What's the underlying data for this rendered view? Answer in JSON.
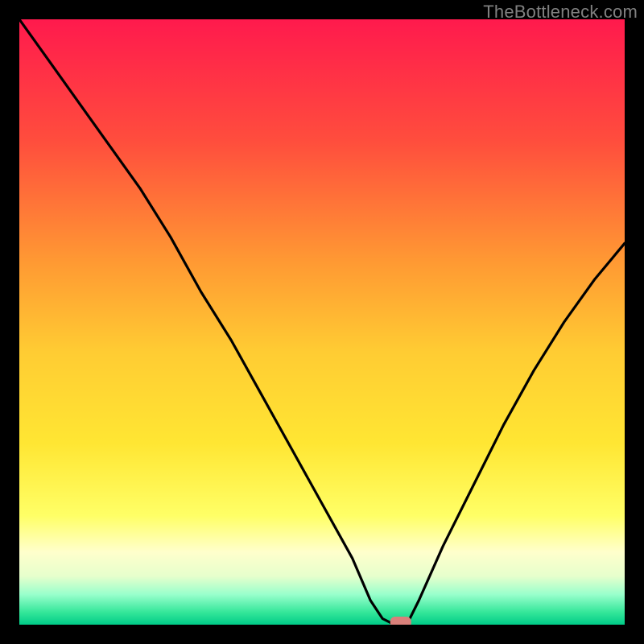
{
  "watermark": "TheBottleneck.com",
  "chart_data": {
    "type": "line",
    "title": "",
    "xlabel": "",
    "ylabel": "",
    "xlim": [
      0,
      100
    ],
    "ylim": [
      0,
      100
    ],
    "grid": false,
    "legend": false,
    "background": {
      "type": "vertical-gradient",
      "stops": [
        {
          "offset": 0.0,
          "color": "#ff1a4d"
        },
        {
          "offset": 0.2,
          "color": "#ff4d3d"
        },
        {
          "offset": 0.4,
          "color": "#ff9933"
        },
        {
          "offset": 0.55,
          "color": "#ffcc33"
        },
        {
          "offset": 0.7,
          "color": "#ffe633"
        },
        {
          "offset": 0.82,
          "color": "#ffff66"
        },
        {
          "offset": 0.88,
          "color": "#ffffcc"
        },
        {
          "offset": 0.92,
          "color": "#e6ffcc"
        },
        {
          "offset": 0.95,
          "color": "#99ffcc"
        },
        {
          "offset": 0.98,
          "color": "#33e699"
        },
        {
          "offset": 1.0,
          "color": "#00cc88"
        }
      ]
    },
    "series": [
      {
        "name": "bottleneck-curve",
        "color": "#000000",
        "x": [
          0,
          5,
          10,
          15,
          20,
          25,
          30,
          35,
          40,
          45,
          50,
          55,
          58,
          60,
          62,
          64,
          66,
          70,
          75,
          80,
          85,
          90,
          95,
          100
        ],
        "y": [
          100,
          93,
          86,
          79,
          72,
          64,
          55,
          47,
          38,
          29,
          20,
          11,
          4,
          1,
          0,
          0,
          4,
          13,
          23,
          33,
          42,
          50,
          57,
          63
        ]
      }
    ],
    "marker": {
      "name": "optimal-point",
      "x": 63,
      "y": 0,
      "color": "#d9807a",
      "shape": "rounded-rect"
    }
  }
}
